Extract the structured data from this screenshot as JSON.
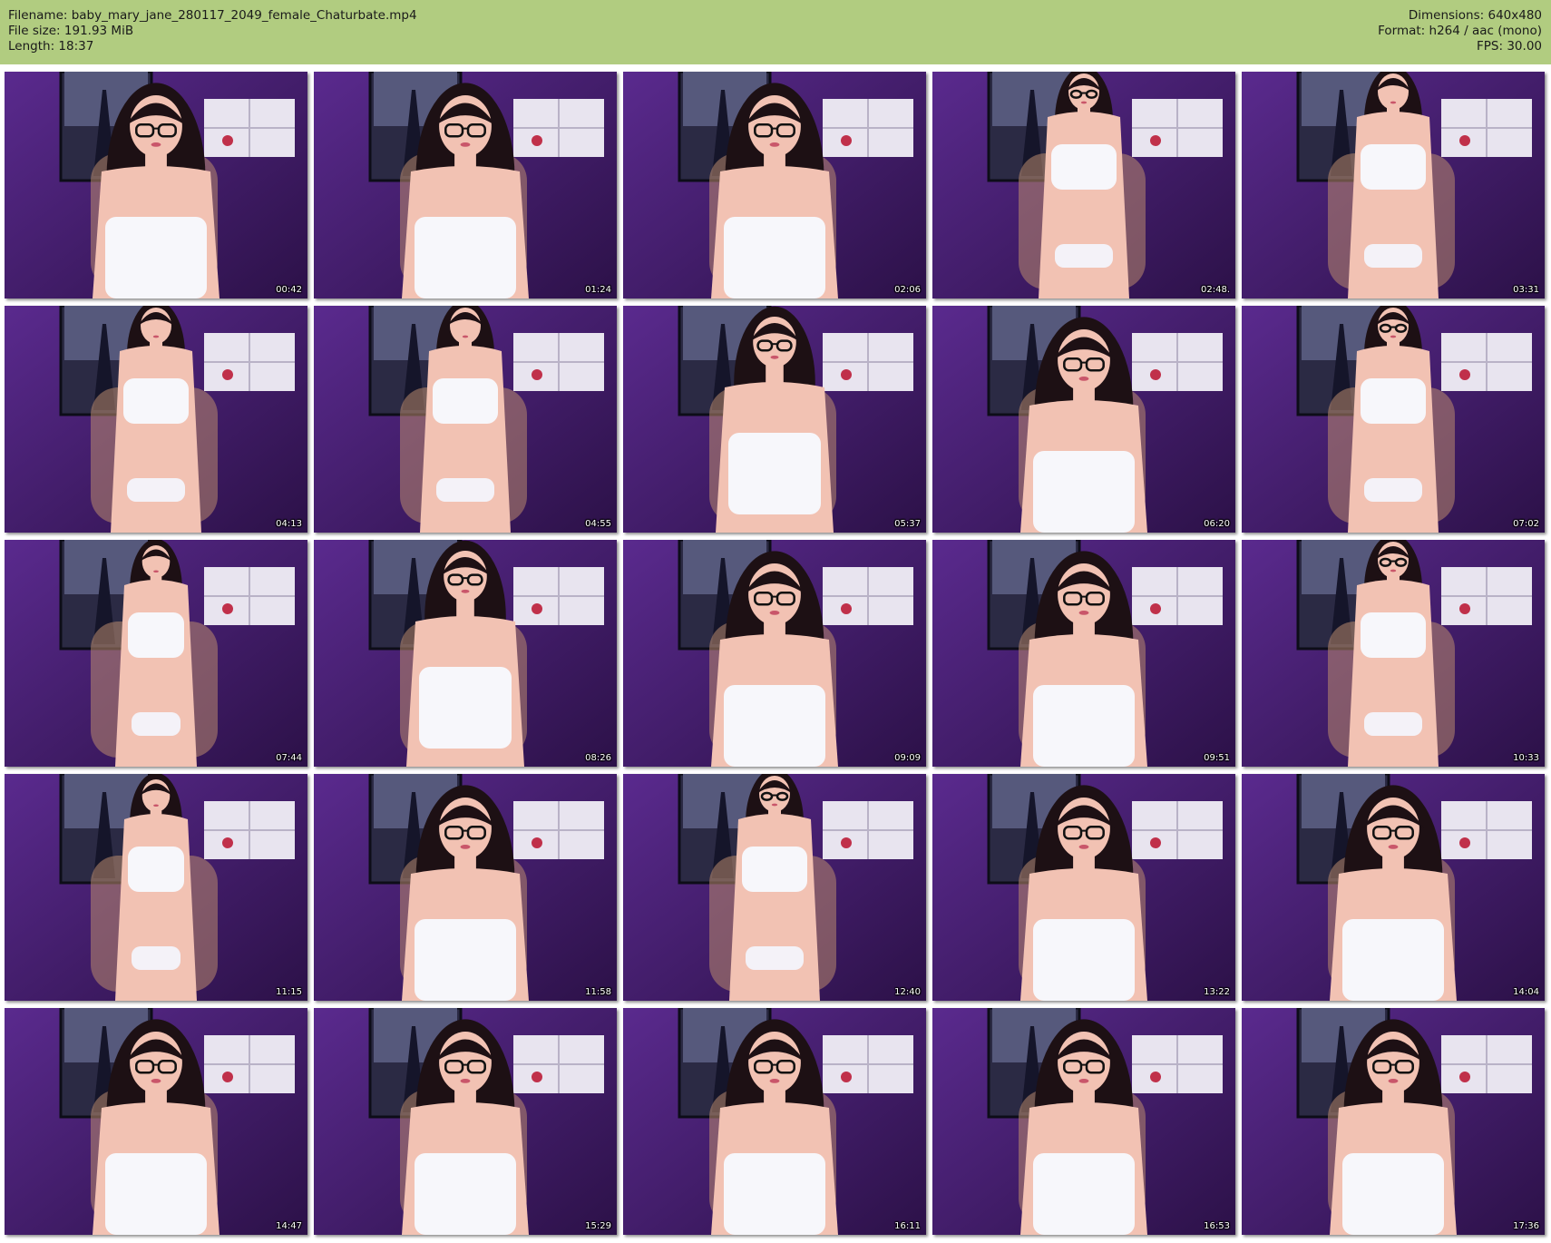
{
  "header": {
    "filename_line": "Filename: baby_mary_jane_280117_2049_female_Chaturbate.mp4",
    "filesize_line": "File size: 191.93 MiB",
    "length_line": "Length: 18:37",
    "dimensions_line": "Dimensions: 640x480",
    "format_line": "Format: h264 / aac (mono)",
    "fps_line": "FPS: 30.00"
  },
  "colors": {
    "header_bg": "#b1cc80",
    "room_wall": "#4a2275",
    "timestamp_text": "#ffffff"
  },
  "thumbnails": [
    {
      "timestamp": "00:42",
      "glasses": true,
      "pose": "closeup"
    },
    {
      "timestamp": "01:24",
      "glasses": true,
      "pose": "closeup"
    },
    {
      "timestamp": "02:06",
      "glasses": true,
      "pose": "closeup"
    },
    {
      "timestamp": "02:48.",
      "glasses": true,
      "pose": "standing"
    },
    {
      "timestamp": "03:31",
      "glasses": false,
      "pose": "standing"
    },
    {
      "timestamp": "04:13",
      "glasses": false,
      "pose": "standing"
    },
    {
      "timestamp": "04:55",
      "glasses": false,
      "pose": "standing"
    },
    {
      "timestamp": "05:37",
      "glasses": true,
      "pose": "mid"
    },
    {
      "timestamp": "06:20",
      "glasses": true,
      "pose": "closeup"
    },
    {
      "timestamp": "07:02",
      "glasses": true,
      "pose": "standing"
    },
    {
      "timestamp": "07:44",
      "glasses": false,
      "pose": "side"
    },
    {
      "timestamp": "08:26",
      "glasses": true,
      "pose": "mid"
    },
    {
      "timestamp": "09:09",
      "glasses": true,
      "pose": "closeup"
    },
    {
      "timestamp": "09:51",
      "glasses": true,
      "pose": "closeup"
    },
    {
      "timestamp": "10:33",
      "glasses": true,
      "pose": "standing"
    },
    {
      "timestamp": "11:15",
      "glasses": false,
      "pose": "side"
    },
    {
      "timestamp": "11:58",
      "glasses": true,
      "pose": "closeup"
    },
    {
      "timestamp": "12:40",
      "glasses": true,
      "pose": "standing"
    },
    {
      "timestamp": "13:22",
      "glasses": true,
      "pose": "closeup"
    },
    {
      "timestamp": "14:04",
      "glasses": true,
      "pose": "closeup"
    },
    {
      "timestamp": "14:47",
      "glasses": true,
      "pose": "closeup"
    },
    {
      "timestamp": "15:29",
      "glasses": true,
      "pose": "closeup"
    },
    {
      "timestamp": "16:11",
      "glasses": true,
      "pose": "closeup"
    },
    {
      "timestamp": "16:53",
      "glasses": true,
      "pose": "closeup"
    },
    {
      "timestamp": "17:36",
      "glasses": true,
      "pose": "closeup"
    }
  ]
}
